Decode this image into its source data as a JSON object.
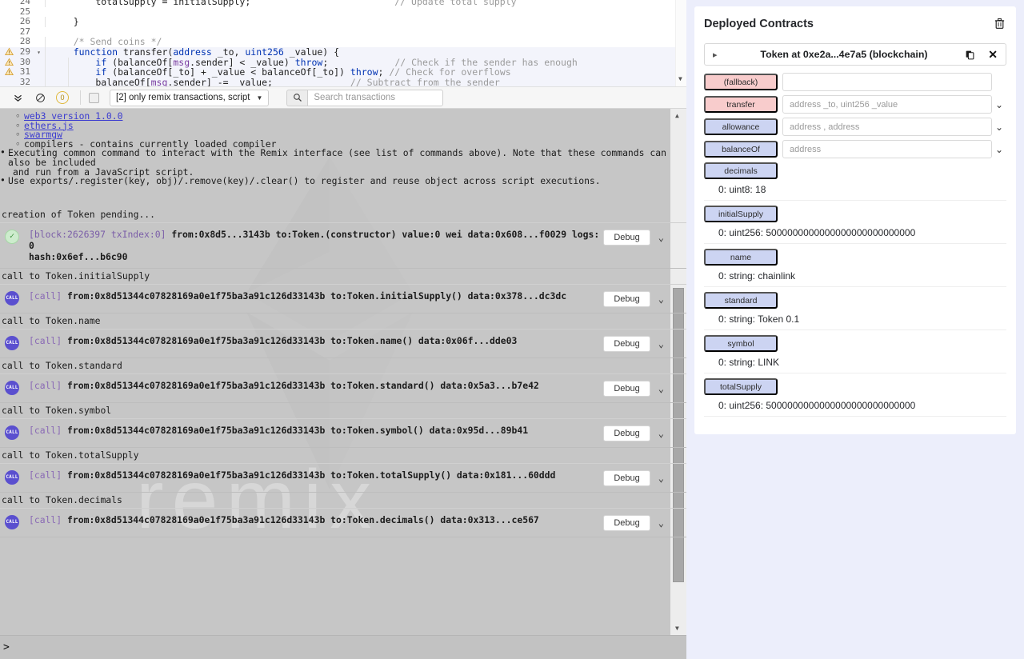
{
  "editor": {
    "lines": [
      {
        "num": "24",
        "warn": false,
        "fold": false,
        "hl": false,
        "indents": 1,
        "tokens": [
          {
            "t": "        totalSupply = initialSupply;",
            "c": "fn"
          },
          {
            "t": "                          // Update total supply",
            "c": "cm"
          }
        ]
      },
      {
        "num": "25",
        "warn": false,
        "fold": false,
        "hl": false,
        "indents": 5,
        "tokens": []
      },
      {
        "num": "26",
        "warn": false,
        "fold": false,
        "hl": false,
        "indents": 1,
        "tokens": [
          {
            "t": "    }",
            "c": "fn"
          }
        ]
      },
      {
        "num": "27",
        "warn": false,
        "fold": false,
        "hl": false,
        "indents": 0,
        "tokens": []
      },
      {
        "num": "28",
        "warn": false,
        "fold": false,
        "hl": false,
        "indents": 1,
        "tokens": [
          {
            "t": "    /* Send coins */",
            "c": "cm"
          }
        ]
      },
      {
        "num": "29",
        "warn": true,
        "fold": true,
        "hl": true,
        "indents": 1,
        "tokens": [
          {
            "t": "    ",
            "c": "fn"
          },
          {
            "t": "function",
            "c": "kw"
          },
          {
            "t": " transfer(",
            "c": "fn"
          },
          {
            "t": "address",
            "c": "typ"
          },
          {
            "t": " _to, ",
            "c": "fn"
          },
          {
            "t": "uint256",
            "c": "typ"
          },
          {
            "t": " _value) {",
            "c": "fn"
          }
        ]
      },
      {
        "num": "30",
        "warn": true,
        "fold": false,
        "hl": true,
        "indents": 2,
        "tokens": [
          {
            "t": "        ",
            "c": "fn"
          },
          {
            "t": "if",
            "c": "kw"
          },
          {
            "t": " (balanceOf[",
            "c": "fn"
          },
          {
            "t": "msg",
            "c": "var"
          },
          {
            "t": ".sender] < _value) ",
            "c": "fn"
          },
          {
            "t": "throw",
            "c": "kw"
          },
          {
            "t": ";",
            "c": "fn"
          },
          {
            "t": "            // Check if the sender has enough",
            "c": "cm"
          }
        ]
      },
      {
        "num": "31",
        "warn": true,
        "fold": false,
        "hl": true,
        "indents": 2,
        "tokens": [
          {
            "t": "        ",
            "c": "fn"
          },
          {
            "t": "if",
            "c": "kw"
          },
          {
            "t": " (balanceOf[_to] + _value < balanceOf[_to]) ",
            "c": "fn"
          },
          {
            "t": "throw",
            "c": "kw"
          },
          {
            "t": "; ",
            "c": "fn"
          },
          {
            "t": "// Check for overflows",
            "c": "cm"
          }
        ]
      },
      {
        "num": "32",
        "warn": false,
        "fold": false,
        "hl": true,
        "indents": 2,
        "tokens": [
          {
            "t": "        balanceOf[",
            "c": "fn"
          },
          {
            "t": "msg",
            "c": "var"
          },
          {
            "t": ".sender] -= _value;",
            "c": "fn"
          },
          {
            "t": "              // Subtract from the sender",
            "c": "cm"
          }
        ]
      }
    ]
  },
  "toolbar": {
    "collapse_icon": "chevron-double-down-icon",
    "ban_icon": "ban-icon",
    "pending_count": "0",
    "checkbox_checked": false,
    "filter_value": "[2] only remix transactions, script",
    "search_icon": "search-icon",
    "search_placeholder": "Search transactions",
    "search_value": ""
  },
  "terminal": {
    "intro": [
      {
        "kind": "sub",
        "parts": [
          {
            "t": "web3 version 1.0.0",
            "link": true
          }
        ]
      },
      {
        "kind": "sub",
        "parts": [
          {
            "t": "ethers.js",
            "link": true
          }
        ]
      },
      {
        "kind": "sub",
        "parts": [
          {
            "t": "swarmgw",
            "link": true
          }
        ]
      },
      {
        "kind": "sub",
        "parts": [
          {
            "t": "compilers - contains currently loaded compiler",
            "link": false
          }
        ]
      },
      {
        "kind": "bullet",
        "parts": [
          {
            "t": "Executing common command to interact with the Remix interface (see list of commands above). Note that these commands can also be included",
            "link": false
          }
        ]
      },
      {
        "kind": "cont",
        "parts": [
          {
            "t": "and run from a JavaScript script.",
            "link": false
          }
        ]
      },
      {
        "kind": "bullet",
        "parts": [
          {
            "t": "Use exports/.register(key, obj)/.remove(key)/.clear() to register and reuse object across script executions.",
            "link": false
          }
        ]
      }
    ],
    "pending_text": "creation of Token pending...",
    "entries": [
      {
        "badge": "ok",
        "badge_label": "✓",
        "meta": "[block:2626397 txIndex:0]",
        "body_html": "from:0x8d5...3143b to:Token.(constructor) value:0 wei data:0x608...f0029 logs:0",
        "second": "hash:0x6ef...b6c90",
        "debug_label": "Debug",
        "chevron": "chevron-down-icon"
      },
      {
        "label": "call to Token.initialSupply",
        "badge": "call",
        "badge_label": "CALL",
        "meta": "[call]",
        "body_html": "from:0x8d51344c07828169a0e1f75ba3a91c126d33143b to:Token.initialSupply() data:0x378...dc3dc",
        "second": "",
        "debug_label": "Debug",
        "chevron": "chevron-down-icon"
      },
      {
        "label": "call to Token.name",
        "badge": "call",
        "badge_label": "CALL",
        "meta": "[call]",
        "body_html": "from:0x8d51344c07828169a0e1f75ba3a91c126d33143b to:Token.name() data:0x06f...dde03",
        "second": "",
        "debug_label": "Debug",
        "chevron": "chevron-down-icon"
      },
      {
        "label": "call to Token.standard",
        "badge": "call",
        "badge_label": "CALL",
        "meta": "[call]",
        "body_html": "from:0x8d51344c07828169a0e1f75ba3a91c126d33143b to:Token.standard() data:0x5a3...b7e42",
        "second": "",
        "debug_label": "Debug",
        "chevron": "chevron-down-icon"
      },
      {
        "label": "call to Token.symbol",
        "badge": "call",
        "badge_label": "CALL",
        "meta": "[call]",
        "body_html": "from:0x8d51344c07828169a0e1f75ba3a91c126d33143b to:Token.symbol() data:0x95d...89b41",
        "second": "",
        "debug_label": "Debug",
        "chevron": "chevron-down-icon"
      },
      {
        "label": "call to Token.totalSupply",
        "badge": "call",
        "badge_label": "CALL",
        "meta": "[call]",
        "body_html": "from:0x8d51344c07828169a0e1f75ba3a91c126d33143b to:Token.totalSupply() data:0x181...60ddd",
        "second": "",
        "debug_label": "Debug",
        "chevron": "chevron-down-icon"
      },
      {
        "label": "call to Token.decimals",
        "badge": "call",
        "badge_label": "CALL",
        "meta": "[call]",
        "body_html": "from:0x8d51344c07828169a0e1f75ba3a91c126d33143b to:Token.decimals() data:0x313...ce567",
        "second": "",
        "debug_label": "Debug",
        "chevron": "chevron-down-icon"
      }
    ],
    "watermark": "remix",
    "prompt_symbol": ">",
    "prompt_value": ""
  },
  "deployed": {
    "title": "Deployed Contracts",
    "trash_icon": "trash-icon",
    "contract": {
      "expand_icon": "caret-right-icon",
      "name": "Token at 0xe2a...4e7a5 (blockchain)",
      "copy_icon": "copy-icon",
      "close_icon": "close-icon"
    },
    "functions": [
      {
        "label": "(fallback)",
        "kind": "write",
        "placeholder": "",
        "caret": false,
        "result": null
      },
      {
        "label": "transfer",
        "kind": "write",
        "placeholder": "address _to, uint256 _value",
        "caret": true,
        "result": null
      },
      {
        "label": "allowance",
        "kind": "read",
        "placeholder": "address , address",
        "caret": true,
        "result": null
      },
      {
        "label": "balanceOf",
        "kind": "read",
        "placeholder": "address",
        "caret": true,
        "result": null
      },
      {
        "label": "decimals",
        "kind": "read",
        "placeholder": null,
        "caret": false,
        "result": "0: uint8: 18"
      },
      {
        "label": "initialSupply",
        "kind": "read",
        "placeholder": null,
        "caret": false,
        "result": "0: uint256: 5000000000000000000000000000"
      },
      {
        "label": "name",
        "kind": "read",
        "placeholder": null,
        "caret": false,
        "result": "0: string: chainlink"
      },
      {
        "label": "standard",
        "kind": "read",
        "placeholder": null,
        "caret": false,
        "result": "0: string: Token 0.1"
      },
      {
        "label": "symbol",
        "kind": "read",
        "placeholder": null,
        "caret": false,
        "result": "0: string: LINK"
      },
      {
        "label": "totalSupply",
        "kind": "read",
        "placeholder": null,
        "caret": false,
        "result": "0: uint256: 5000000000000000000000000000"
      }
    ]
  },
  "colors": {
    "panel_bg": "#eceefb",
    "terminal_bg": "#c6c6c6",
    "write_fn": "#f8cccc",
    "read_fn": "#ccd4f2",
    "call_badge": "#5a4fcf",
    "link": "#3c3cd0"
  }
}
